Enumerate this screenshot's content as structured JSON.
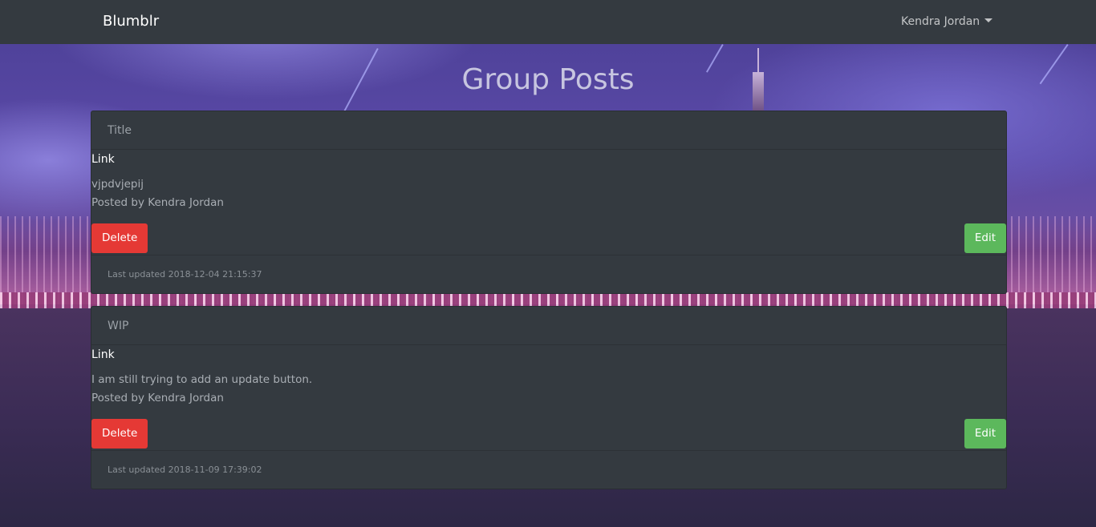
{
  "navbar": {
    "brand": "Blumblr",
    "user_name": "Kendra Jordan",
    "user_menu_icon": "caret-down-icon"
  },
  "page": {
    "title": "Group Posts"
  },
  "posts": [
    {
      "title": "Title",
      "link_label": "Link",
      "description": "vjpdvjepij",
      "author_line": "Posted by Kendra Jordan",
      "delete_label": "Delete",
      "edit_label": "Edit",
      "footer": "Last updated 2018-12-04 21:15:37"
    },
    {
      "title": "WIP",
      "link_label": "Link",
      "description": "I am still trying to add an update button.",
      "author_line": "Posted by Kendra Jordan",
      "delete_label": "Delete",
      "edit_label": "Edit",
      "footer": "Last updated 2018-11-09 17:39:02"
    }
  ],
  "colors": {
    "navbar_bg": "#343a40",
    "card_bg": "#343a40",
    "delete_button": "#e53935",
    "edit_button": "#5cb85c"
  }
}
